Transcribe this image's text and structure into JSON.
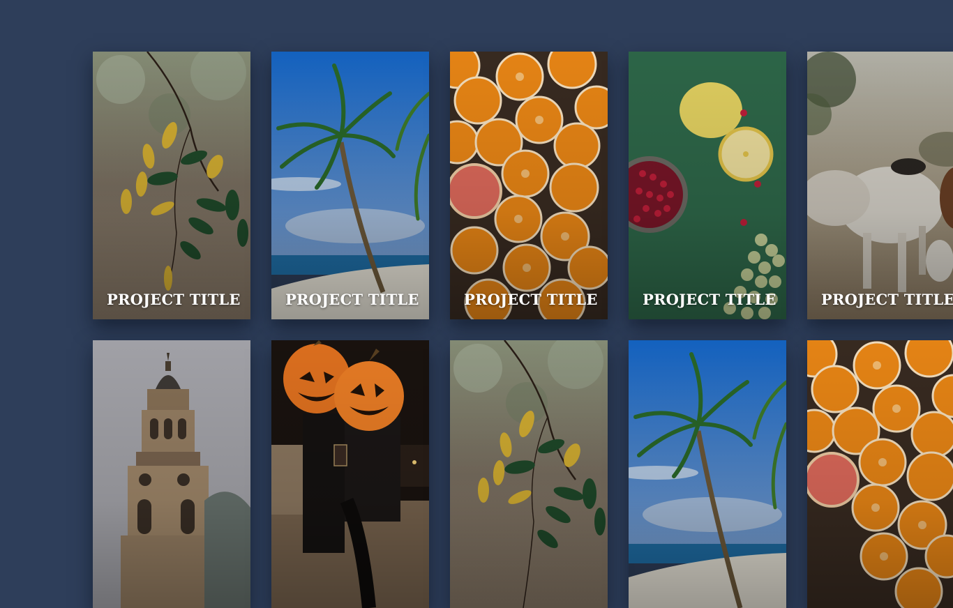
{
  "gallery": {
    "cards": [
      {
        "title": "PROJECT TITLE",
        "image": "autumn-branch-leaves-photo"
      },
      {
        "title": "PROJECT TITLE",
        "image": "palm-tree-beach-photo"
      },
      {
        "title": "PROJECT TITLE",
        "image": "sliced-oranges-photo"
      },
      {
        "title": "PROJECT TITLE",
        "image": "lemons-cranberries-grapes-photo"
      },
      {
        "title": "PROJECT TITLE",
        "image": "white-cattle-photo"
      },
      {
        "title": "",
        "image": "church-tower-photo"
      },
      {
        "title": "",
        "image": "pumpkin-head-couple-photo"
      },
      {
        "title": "",
        "image": "autumn-branch-leaves-photo"
      },
      {
        "title": "",
        "image": "palm-tree-beach-photo"
      },
      {
        "title": "",
        "image": "sliced-oranges-photo"
      }
    ]
  },
  "colors": {
    "background": "#2e3e5a",
    "title_text": "#ffffff"
  }
}
